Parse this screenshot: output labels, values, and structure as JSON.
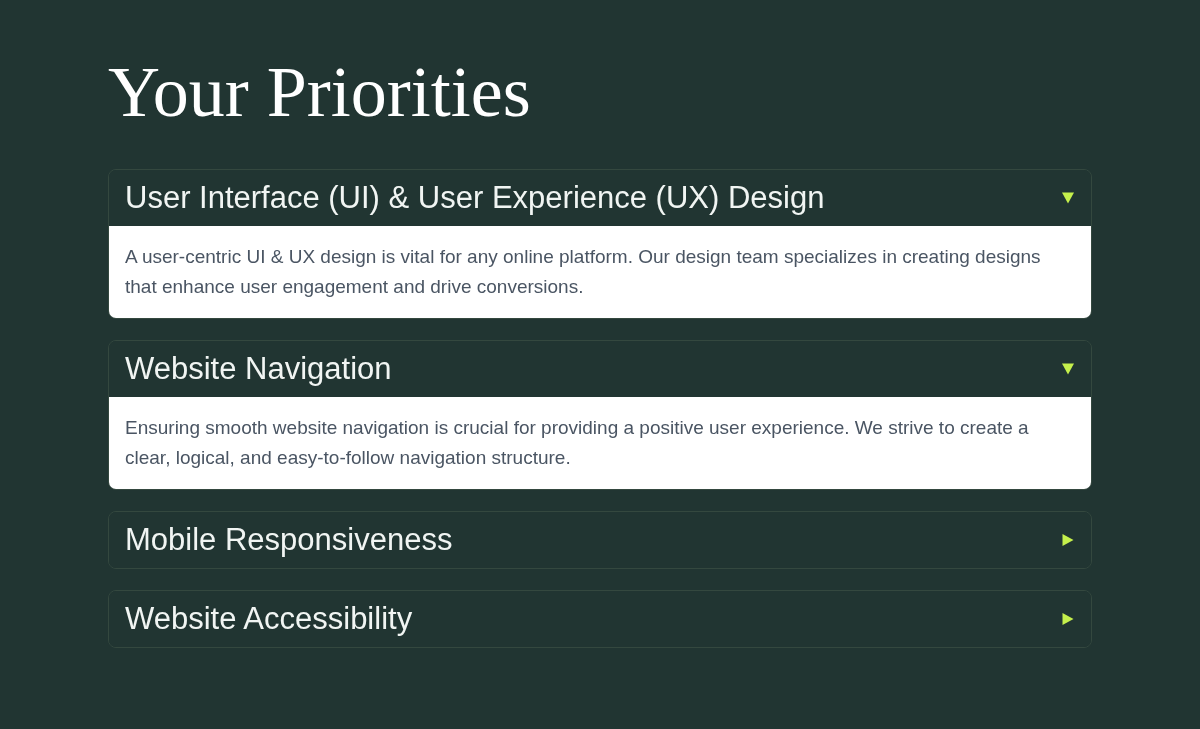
{
  "heading": "Your Priorities",
  "items": [
    {
      "title": "User Interface (UI) & User Experience (UX) Design",
      "expanded": true,
      "body": "A user-centric UI & UX design is vital for any online platform. Our design team specializes in creating designs that enhance user engagement and drive conversions."
    },
    {
      "title": "Website Navigation",
      "expanded": true,
      "body": "Ensuring smooth website navigation is crucial for providing a positive user experience. We strive to create a clear, logical, and easy-to-follow navigation structure."
    },
    {
      "title": "Mobile Responsiveness",
      "expanded": false
    },
    {
      "title": "Website Accessibility",
      "expanded": false
    }
  ]
}
